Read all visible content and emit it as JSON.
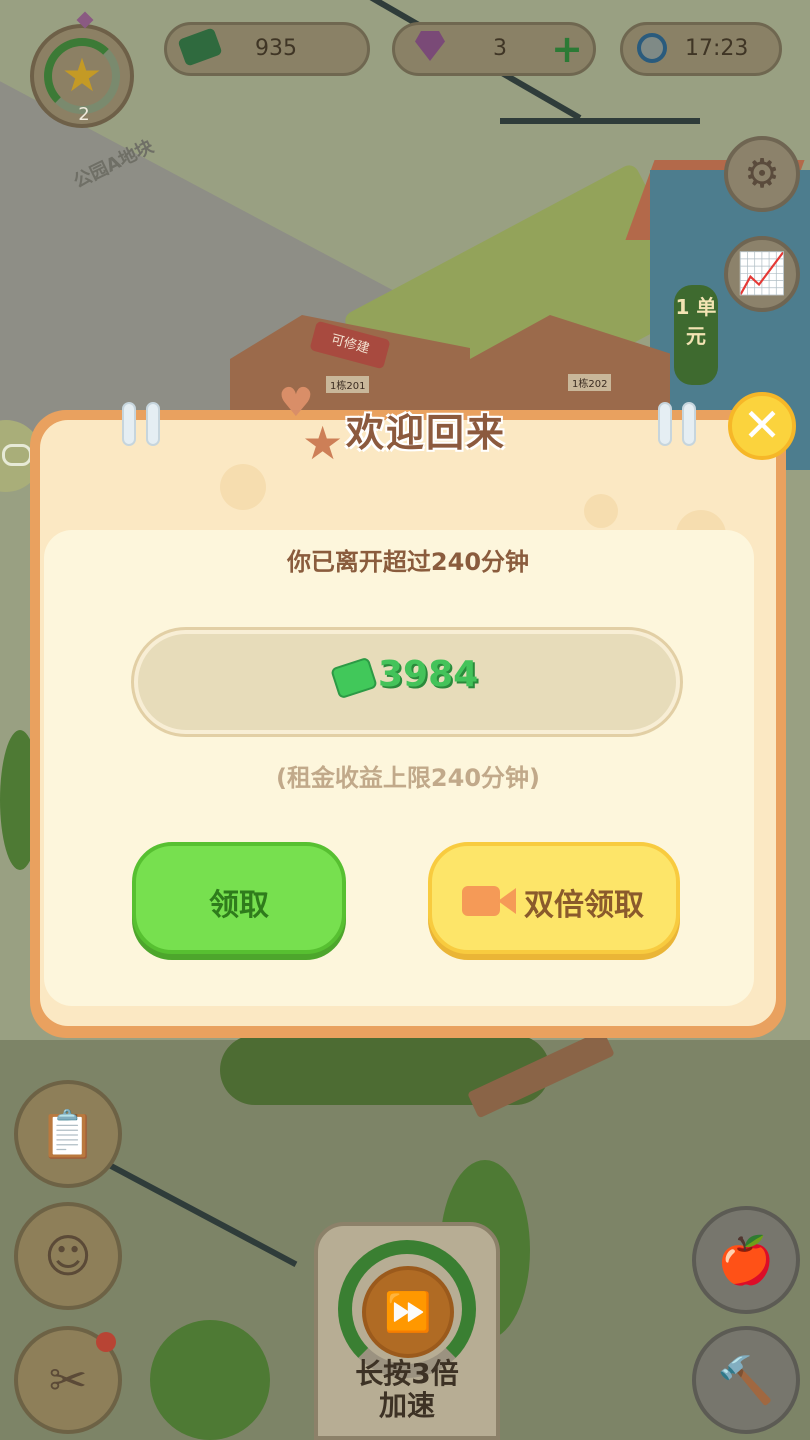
{
  "hud": {
    "level": "2",
    "cash": "935",
    "gems": "3",
    "time": "17:23"
  },
  "world": {
    "site_label": "公园A地块",
    "build_sign": "可修建",
    "unit_sign": "1 单元",
    "house_left": "1栋201",
    "house_right": "1栋202"
  },
  "dialog": {
    "title": "欢迎回来",
    "leave_message": "你已离开超过240分钟",
    "reward_amount": "3984",
    "limit_note": "(租金收益上限240分钟)",
    "claim_label": "领取",
    "double_claim_label": "双倍领取"
  },
  "speed": {
    "label_line1": "长按3倍",
    "label_line2": "加速"
  },
  "colors": {
    "accent_green": "#77e04f",
    "accent_yellow": "#fde569",
    "dialog_frame": "#e9a15f",
    "cash_green": "#44c35a"
  },
  "icons": {
    "cash": "cash-icon",
    "gem": "gem-icon",
    "add": "plus-icon",
    "clock": "clock-icon",
    "settings": "gear-icon",
    "stats": "chart-icon",
    "close": "close-icon",
    "video": "video-camera-icon",
    "tasks": "clipboard-icon",
    "character": "face-icon",
    "tools": "tools-icon",
    "fast_forward": "fast-forward-icon",
    "fruit": "apple-icon",
    "build": "hammer-icon",
    "gamepad": "gamepad-icon"
  }
}
